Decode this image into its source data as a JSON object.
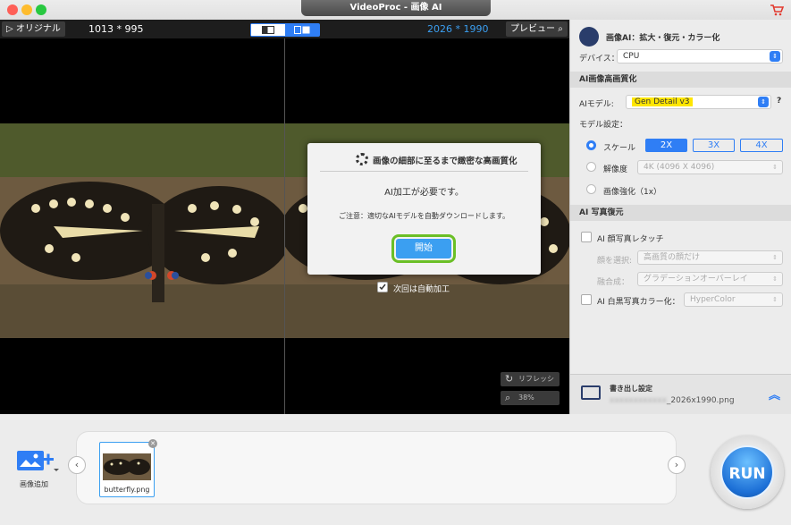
{
  "window": {
    "title": "VideoProc - 画像 AI"
  },
  "viewer": {
    "original_label": "オリジナル",
    "original_res": "1013 * 995",
    "output_res": "2026 * 1990",
    "preview_label": "プレビュー",
    "refresh_label": "リフレッシュ",
    "zoom": "38%"
  },
  "dialog": {
    "title": "画像の細部に至るまで緻密な高画質化",
    "heading": "AI加工が必要です。",
    "note": "ご注意：適切なAIモデルを自動ダウンロードします。",
    "start_label": "開始",
    "auto_label": "次回は自動加工"
  },
  "panel": {
    "header_title": "画像AI：拡大・復元・カラー化",
    "device_label": "デバイス：",
    "device_value": "CPU",
    "sec_enhance": "AI画像高画質化",
    "model_label": "AIモデル:",
    "model_value": "Gen Detail v3",
    "model_settings": "モデル設定：",
    "scale_label": "スケール",
    "scale_options": [
      "2X",
      "3X",
      "4X"
    ],
    "resolution_label": "解像度",
    "resolution_value": "4K (4096 X 4096)",
    "enhance_label": "画像強化（1x）",
    "sec_restore": "AI 写真復元",
    "face_label": "AI 顔写真レタッチ",
    "face_select_label": "顔を選択:",
    "face_select_value": "高画質の顔だけ",
    "blend_label": "融合成：",
    "blend_value": "グラデーションオーバーレイ",
    "colorize_label": "AI 白黒写真カラー化：",
    "colorize_value": "HyperColor",
    "export_label": "書き出し設定",
    "export_file": "_2026x1990.png",
    "export_blurred": "xxxxxxxxxxxx"
  },
  "bottom": {
    "add_label": "画像追加",
    "thumb_name": "butterfly.png",
    "run_label": "RUN"
  },
  "colors": {
    "accent": "#2f7ef5",
    "highlight": "#ffe600",
    "start": "#3b9ff1",
    "start_outline": "#6bbf26"
  }
}
